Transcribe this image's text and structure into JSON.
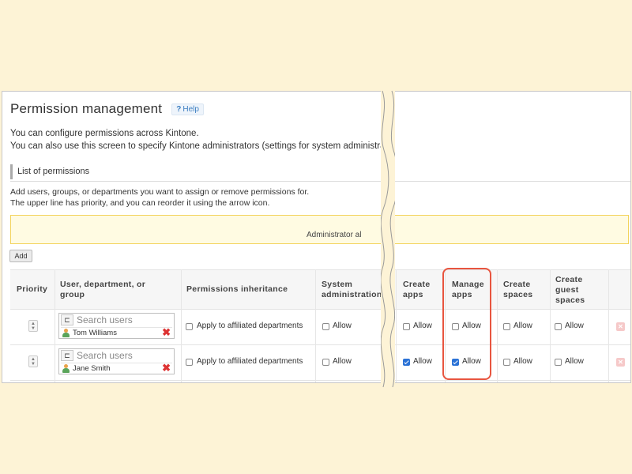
{
  "page": {
    "title": "Permission management",
    "help_label": "Help",
    "description_line1": "You can configure permissions across Kintone.",
    "description_line2": "You can also use this screen to specify Kintone administrators (settings for system administra"
  },
  "section": {
    "title": "List of permissions",
    "instruction_line1": "Add users, groups, or departments you want to assign or remove permissions for.",
    "instruction_line2": "The upper line has priority, and you can reorder it using the arrow icon."
  },
  "admin_banner_text": "Administrator al",
  "add_button_label": "Add",
  "table": {
    "headers": {
      "priority": "Priority",
      "user_line1": "User, department, or",
      "user_line2": "group",
      "inheritance": "Permissions inheritance",
      "sysadmin_line1": "System",
      "sysadmin_line2": "administration",
      "create_apps_line1": "Create",
      "create_apps_line2": "apps",
      "manage_apps_line1": "Manage",
      "manage_apps_line2": "apps",
      "create_spaces_line1": "Create",
      "create_spaces_line2": "spaces",
      "guest_line1": "Create",
      "guest_line2": "guest",
      "guest_line3": "spaces"
    },
    "search_placeholder": "Search users",
    "inheritance_label": "Apply to affiliated departments",
    "allow_label": "Allow",
    "rows": [
      {
        "user": "Tom Williams",
        "inheritance": false,
        "system_administration": false,
        "create_apps": false,
        "manage_apps": false,
        "create_spaces": false,
        "create_guest_spaces": false
      },
      {
        "user": "Jane Smith",
        "inheritance": false,
        "system_administration": false,
        "create_apps": true,
        "manage_apps": true,
        "create_spaces": false,
        "create_guest_spaces": false
      }
    ]
  },
  "colors": {
    "highlight": "#e8553f",
    "checkbox_checked": "#2b72d6",
    "banner_border": "#f3d35b",
    "background": "#fdf3d6"
  }
}
